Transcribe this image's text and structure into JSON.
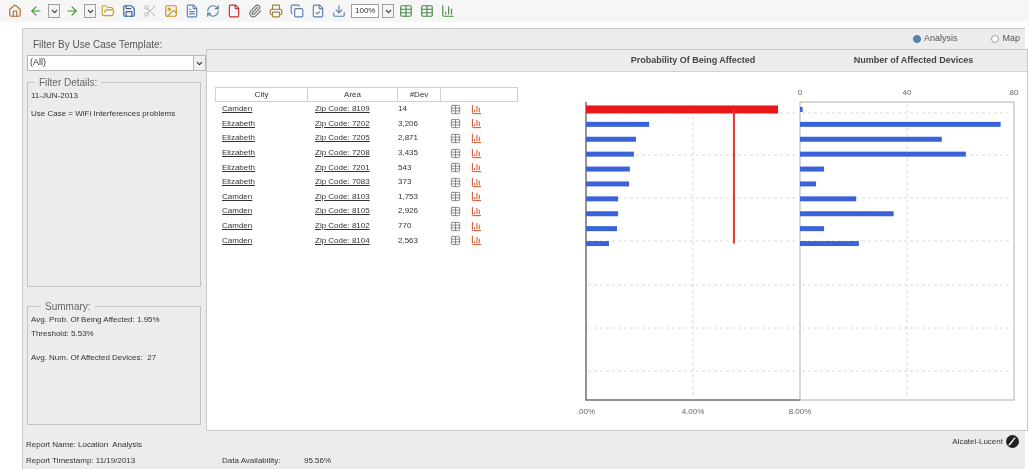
{
  "toolbar": {
    "zoom": "100%"
  },
  "view_options": [
    {
      "label": "Analysis",
      "selected": true
    },
    {
      "label": "Map",
      "selected": false
    }
  ],
  "filter": {
    "label": "Filter By Use Case Template:",
    "value": "(All)"
  },
  "filter_details": {
    "title": "Filter Details:",
    "lines": [
      "11-JUN-2013",
      "Use Case = WiFi Interferences problems"
    ]
  },
  "summary": {
    "title": "Summary:",
    "groups": [
      [
        "Avg. Prob. Of Being Affected: 1.95%",
        "Threshold: 5.53%"
      ],
      [
        "Avg. Num. Of Affected Devices:  27"
      ]
    ]
  },
  "table": {
    "columns": [
      "City",
      "Area",
      "#Dev"
    ],
    "rows": [
      {
        "city": "Camden",
        "area": "Zip Code: 8109",
        "dev": "14"
      },
      {
        "city": "Elizabeth",
        "area": "Zip Code: 7202",
        "dev": "3,206"
      },
      {
        "city": "Elizabeth",
        "area": "Zip Code: 7205",
        "dev": "2,871"
      },
      {
        "city": "Elizabeth",
        "area": "Zip Code: 7208",
        "dev": "3,435"
      },
      {
        "city": "Elizabeth",
        "area": "Zip Code: 7201",
        "dev": "543"
      },
      {
        "city": "Elizabeth",
        "area": "Zip Code: 7083",
        "dev": "373"
      },
      {
        "city": "Camden",
        "area": "Zip Code: 8103",
        "dev": "1,753"
      },
      {
        "city": "Camden",
        "area": "Zip Code: 8105",
        "dev": "2,926"
      },
      {
        "city": "Camden",
        "area": "Zip Code: 8102",
        "dev": "770"
      },
      {
        "city": "Camden",
        "area": "Zip Code: 8104",
        "dev": "2,563"
      }
    ]
  },
  "charts": [
    {
      "chart_data": {
        "type": "bar",
        "orientation": "horizontal",
        "title": "Probability Of Being Affected",
        "xlim": [
          0,
          8
        ],
        "xticks": [
          {
            "value": 0,
            "label": ".00%"
          },
          {
            "value": 4,
            "label": "4.00%"
          },
          {
            "value": 8,
            "label": "8.00%"
          }
        ],
        "stacked": true,
        "grid": true,
        "series": [
          {
            "color": "#e81818",
            "values": [
              7.18,
              null,
              null,
              null,
              null,
              null,
              null,
              null,
              null,
              null,
              null,
              null,
              null,
              null,
              null,
              null,
              null,
              null,
              null,
              null
            ]
          },
          {
            "color": "#3a63d8",
            "values": [
              null,
              2.36,
              1.87,
              1.79,
              1.64,
              1.61,
              1.2,
              1.2,
              1.16,
              0.86,
              null,
              null,
              null,
              null,
              null,
              null,
              null,
              null,
              null,
              null
            ]
          }
        ],
        "ref_lines": [
          {
            "axis": "x",
            "value": 5.53,
            "color": "#f03030"
          }
        ]
      }
    },
    {
      "chart_data": {
        "type": "bar",
        "orientation": "horizontal",
        "title": "Number of Affected Devices",
        "xlim": [
          0,
          80
        ],
        "xticks": [
          {
            "value": 0,
            "label": "0"
          },
          {
            "value": 40,
            "label": "40"
          },
          {
            "value": 80,
            "label": "80"
          }
        ],
        "grid": true,
        "series": [
          {
            "color": "#3a63d8",
            "values": [
              1,
              75,
              53,
              62,
              9,
              6,
              21,
              35,
              9,
              22,
              null,
              null,
              null,
              null,
              null,
              null,
              null,
              null,
              null,
              null
            ]
          }
        ]
      }
    }
  ],
  "footer": {
    "report_name": "Report Name: Location  Analysis",
    "report_timestamp": "Report Timestamp: 11/19/2013",
    "availability_label": "Data Availability:",
    "availability_value": "95.56%",
    "logo": "Alcatel-Lucent"
  }
}
